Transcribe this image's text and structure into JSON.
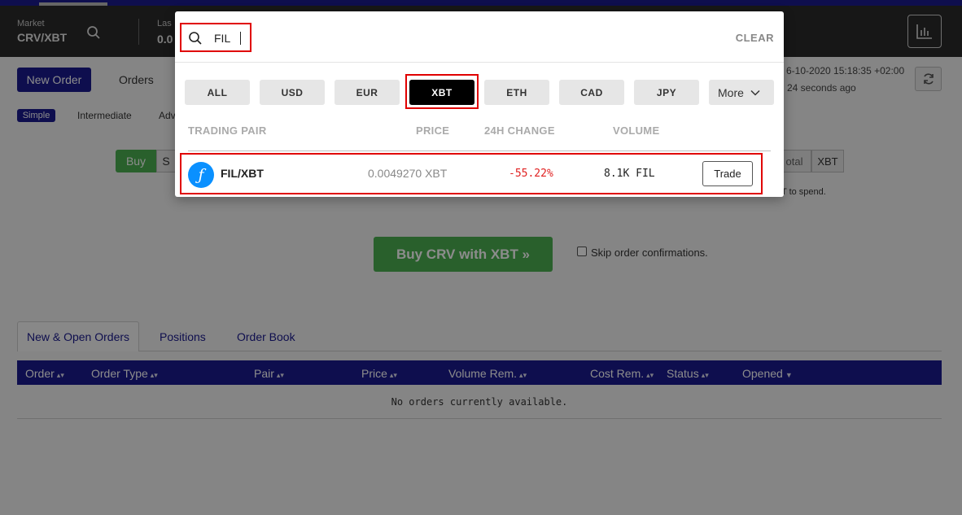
{
  "header": {
    "market_label": "Market",
    "market_pair": "CRV/XBT",
    "last_label": "Las",
    "last_value": "0.0"
  },
  "subnav": {
    "new_order_label": "New Order",
    "orders_label": "Orders",
    "modes": [
      "Simple",
      "Intermediate",
      "Adv"
    ]
  },
  "status": {
    "timestamp": "6-10-2020 15:18:35 +02:00",
    "updated": "24 seconds ago"
  },
  "order_form": {
    "buy_label": "Buy",
    "sell_label": "S",
    "total_label": "otal",
    "currency_label": "XBT",
    "spend_hint": "T to spend.",
    "submit_label": "Buy CRV with XBT »",
    "skip_label": "Skip order confirmations."
  },
  "bottom_tabs": [
    "New & Open Orders",
    "Positions",
    "Order Book"
  ],
  "orders_table": {
    "columns": [
      "Order",
      "Order Type",
      "Pair",
      "Price",
      "Volume Rem.",
      "Cost Rem.",
      "Status",
      "Opened"
    ],
    "sort_glyph": "▴▾",
    "opened_glyph": "▼",
    "empty_message": "No orders currently available."
  },
  "pair_search": {
    "query": "FIL",
    "clear_label": "CLEAR",
    "filters": [
      "ALL",
      "USD",
      "EUR",
      "XBT",
      "ETH",
      "CAD",
      "JPY"
    ],
    "active_filter": "XBT",
    "more_label": "More",
    "columns": [
      "TRADING PAIR",
      "PRICE",
      "24H CHANGE",
      "VOLUME"
    ],
    "results": [
      {
        "coin_glyph": "ƒ",
        "pair": "FIL/XBT",
        "price": "0.0049270 XBT",
        "change": "-55.22%",
        "volume": "8.1K FIL",
        "action": "Trade"
      }
    ]
  },
  "colors": {
    "brand": "#1a1a8e",
    "buy_green": "#4caf50",
    "highlight_red": "#e00000",
    "negative_change": "#e02020",
    "fil_blue": "#0a90ff"
  }
}
